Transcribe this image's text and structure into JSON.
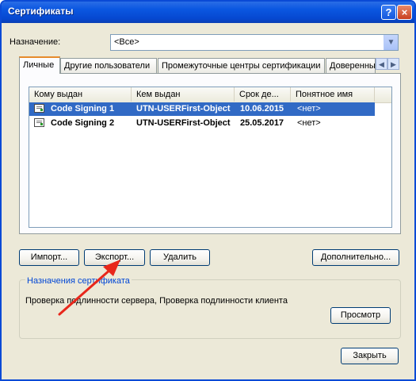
{
  "window": {
    "title": "Сертификаты",
    "help_glyph": "?",
    "close_glyph": "×"
  },
  "purpose": {
    "label": "Назначение:",
    "value": "<Все>"
  },
  "tabs": [
    {
      "label": "Личные"
    },
    {
      "label": "Другие пользователи"
    },
    {
      "label": "Промежуточные центры сертификации"
    },
    {
      "label": "Доверенные"
    }
  ],
  "list": {
    "columns": [
      "Кому выдан",
      "Кем выдан",
      "Срок де...",
      "Понятное имя"
    ],
    "rows": [
      {
        "issued_to": "Code Signing 1",
        "issued_by": "UTN-USERFirst-Object",
        "expires": "10.06.2015",
        "friendly_name": "<нет>",
        "selected": true
      },
      {
        "issued_to": "Code Signing 2",
        "issued_by": "UTN-USERFirst-Object",
        "expires": "25.05.2017",
        "friendly_name": "<нет>",
        "selected": false
      }
    ]
  },
  "buttons": {
    "import": "Импорт...",
    "export": "Экспорт...",
    "delete": "Удалить",
    "advanced": "Дополнительно...",
    "view": "Просмотр",
    "close": "Закрыть"
  },
  "cert_purposes": {
    "title": "Назначения сертификата",
    "text": "Проверка подлинности сервера, Проверка подлинности клиента"
  },
  "colors": {
    "titlebar": "#0b57e1",
    "selection": "#316ac5",
    "annotation_arrow": "#e8271b",
    "group_title": "#0046d5"
  }
}
